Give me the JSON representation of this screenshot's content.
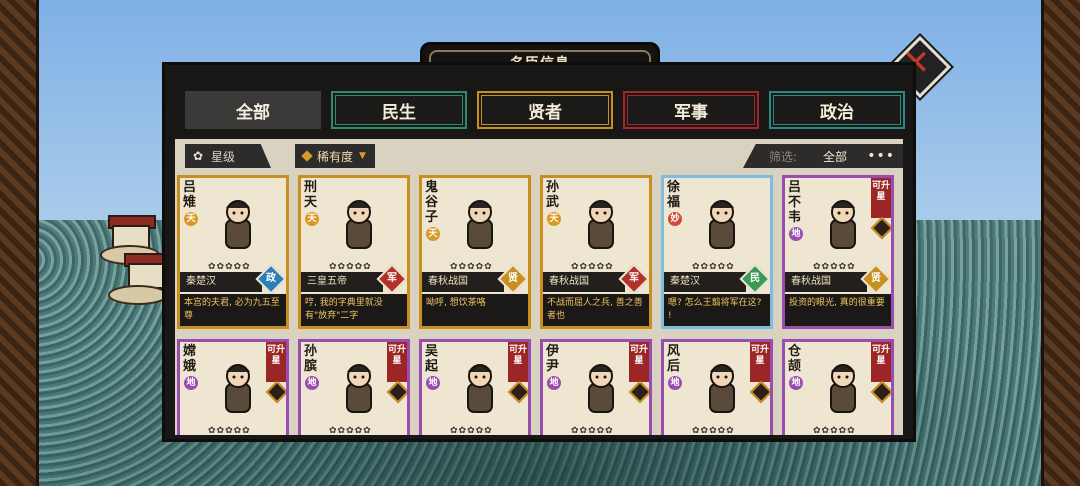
{
  "window": {
    "title": "名臣信息"
  },
  "tabs": [
    {
      "label": "全部",
      "active": true
    },
    {
      "label": "民生"
    },
    {
      "label": "贤者"
    },
    {
      "label": "军事"
    },
    {
      "label": "政治"
    }
  ],
  "filters": {
    "star_sort": "星级",
    "rarity_sort": "稀有度",
    "filter_label": "筛选:",
    "filter_value": "全部",
    "more": "•••"
  },
  "close_icon": "close-icon",
  "colors": {
    "tab_green": "#2f8a6a",
    "tab_yellow": "#c8901e",
    "tab_red": "#a1262a",
    "tab_teal": "#2a8a82",
    "card_gold": "#c98f1e",
    "card_purple": "#9a4db0",
    "card_blue": "#7bbce0"
  },
  "cards": [
    {
      "name": "吕雉",
      "grade": "天",
      "era": "秦楚汉",
      "role": "政",
      "quote": "本宫的夫君, 必为九五至尊",
      "stars": "✿✿✿✿✿"
    },
    {
      "name": "刑天",
      "grade": "天",
      "era": "三皇五帝",
      "role": "军",
      "quote": "哼, 我的字典里就没有\"放弃\"二字",
      "stars": "✿✿✿✿✿"
    },
    {
      "name": "鬼谷子",
      "grade": "天",
      "era": "春秋战国",
      "role": "贤",
      "quote": "呦呼, 想饮茶咯",
      "stars": "✿✿✿✿✿"
    },
    {
      "name": "孙武",
      "grade": "天",
      "era": "春秋战国",
      "role": "军",
      "quote": "不战而屈人之兵, 善之善者也",
      "stars": "✿✿✿✿✿"
    },
    {
      "name": "徐福",
      "grade": "妙",
      "era": "秦楚汉",
      "role": "民",
      "quote": "嗯? 怎么王翦将军在这? !",
      "stars": "✿✿✿✿✿"
    },
    {
      "name": "吕不韦",
      "grade": "地",
      "era": "春秋战国",
      "role": "贤",
      "quote": "投资的眼光, 真的很重要",
      "stars": "✿✿✿✿✿",
      "upgrade": "可升星"
    },
    {
      "name": "嫦娥",
      "grade": "地",
      "upgrade": "可升星",
      "stars": "✿✿✿✿✿"
    },
    {
      "name": "孙膑",
      "grade": "地",
      "upgrade": "可升星",
      "stars": "✿✿✿✿✿"
    },
    {
      "name": "吴起",
      "grade": "地",
      "upgrade": "可升星",
      "stars": "✿✿✿✿✿"
    },
    {
      "name": "伊尹",
      "grade": "地",
      "upgrade": "可升星",
      "stars": "✿✿✿✿✿"
    },
    {
      "name": "风后",
      "grade": "地",
      "upgrade": "可升星",
      "stars": "✿✿✿✿✿"
    },
    {
      "name": "仓颉",
      "grade": "地",
      "upgrade": "可升星",
      "stars": "✿✿✿✿✿"
    }
  ]
}
